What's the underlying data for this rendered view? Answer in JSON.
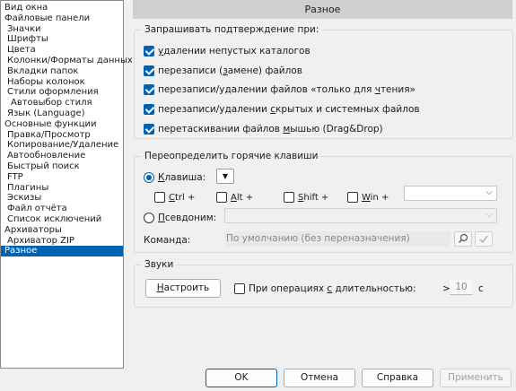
{
  "sidebar": {
    "items": [
      {
        "label": "Вид окна",
        "level": 0
      },
      {
        "label": "Файловые панели",
        "level": 0
      },
      {
        "label": "Значки",
        "level": 1
      },
      {
        "label": "Шрифты",
        "level": 1
      },
      {
        "label": "Цвета",
        "level": 1
      },
      {
        "label": "Колонки/Форматы данных",
        "level": 1
      },
      {
        "label": "Вкладки папок",
        "level": 1
      },
      {
        "label": "Наборы колонок",
        "level": 1
      },
      {
        "label": "Стили оформления",
        "level": 1
      },
      {
        "label": "Автовыбор стиля",
        "level": 2
      },
      {
        "label": "Язык (Language)",
        "level": 1
      },
      {
        "label": "Основные функции",
        "level": 0
      },
      {
        "label": "Правка/Просмотр",
        "level": 1
      },
      {
        "label": "Копирование/Удаление",
        "level": 1
      },
      {
        "label": "Автообновление",
        "level": 1
      },
      {
        "label": "Быстрый поиск",
        "level": 1
      },
      {
        "label": "FTP",
        "level": 1
      },
      {
        "label": "Плагины",
        "level": 1
      },
      {
        "label": "Эскизы",
        "level": 1
      },
      {
        "label": "Файл отчёта",
        "level": 1
      },
      {
        "label": "Список исключений",
        "level": 1
      },
      {
        "label": "Архиваторы",
        "level": 0
      },
      {
        "label": "Архиватор ZIP",
        "level": 1
      },
      {
        "label": "Разное",
        "level": 0,
        "selected": true
      }
    ]
  },
  "header": {
    "title": "Разное"
  },
  "confirm": {
    "title": "Запрашивать подтверждение при:",
    "items": [
      {
        "pre": "",
        "u": "у",
        "post": "далении непустых каталогов",
        "checked": true
      },
      {
        "pre": "перезаписи (",
        "u": "з",
        "post": "амене) файлов",
        "checked": true
      },
      {
        "pre": "перезаписи/удалении файлов «только для ",
        "u": "ч",
        "post": "тения»",
        "checked": true
      },
      {
        "pre": "перезаписи/удалении ",
        "u": "с",
        "post": "крытых и системных файлов",
        "checked": true
      },
      {
        "pre": "перетаскивании файлов ",
        "u": "м",
        "post": "ышью (Drag&Drop)",
        "checked": true
      }
    ]
  },
  "hotkeys": {
    "title": "Переопределить горячие клавиши",
    "key_radio": {
      "u": "К",
      "rest": "лавиша:"
    },
    "key_dropdown_glyph": "▼",
    "mods": [
      {
        "u": "C",
        "rest": "trl +"
      },
      {
        "u": "A",
        "rest": "lt +"
      },
      {
        "u": "S",
        "rest": "hift +"
      },
      {
        "u": "W",
        "rest": "in +"
      }
    ],
    "alias_radio": {
      "u": "П",
      "rest": "севдоним:"
    },
    "command_label": "Команда:",
    "command_value": "По умолчанию (без переназначения)"
  },
  "sounds": {
    "title": "Звуки",
    "configure_button": {
      "u": "Н",
      "rest": "астроить"
    },
    "duration_check": {
      "pre": "При операциях ",
      "u": "с",
      "post": " длительностью:"
    },
    "gt": ">",
    "seconds_value": "10",
    "seconds_unit": "с"
  },
  "footer": {
    "ok": "OK",
    "cancel": "Отмена",
    "help": "Справка",
    "apply": "Применить"
  }
}
